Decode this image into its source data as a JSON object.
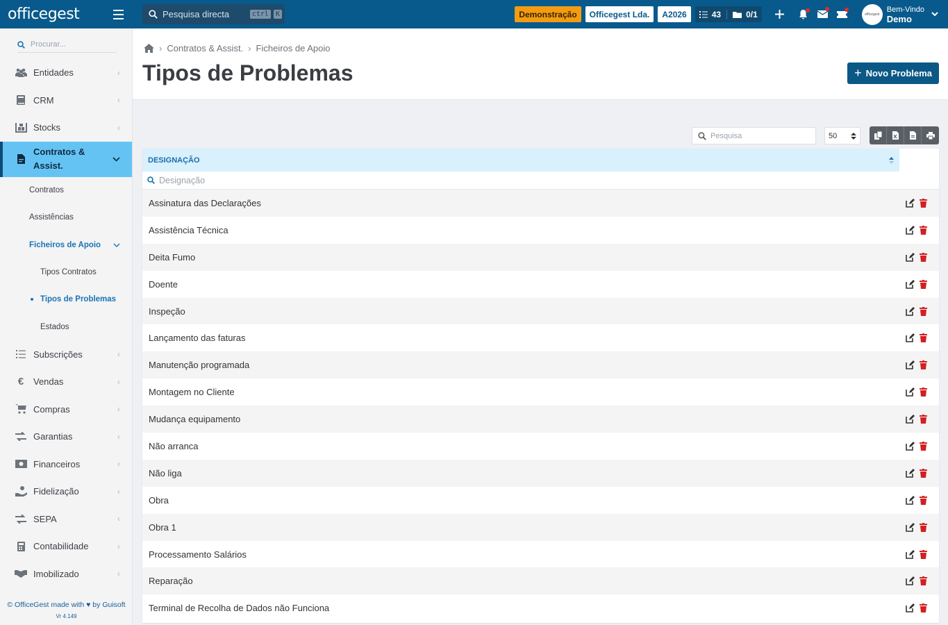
{
  "app": {
    "logo": "officegest"
  },
  "topbar": {
    "quick_search": "Pesquisa directa",
    "kbd1": "ctrl",
    "kbd2": "K",
    "demo": "Demonstração",
    "company": "Officegest Lda.",
    "year": "A2026",
    "tasks": "43",
    "docs": "0/1",
    "welcome": "Bem-Vindo",
    "user": "Demo",
    "avatar_text": "officegest"
  },
  "sidebar": {
    "search_placeholder": "Procurar...",
    "items_top": [
      {
        "label": "Entidades",
        "icon": "users-icon"
      },
      {
        "label": "CRM",
        "icon": "book-icon"
      },
      {
        "label": "Stocks",
        "icon": "warehouse-icon"
      }
    ],
    "active": {
      "label": "Contratos & Assist.",
      "icon": "contract-icon"
    },
    "sub": {
      "contratos": "Contratos",
      "assistencias": "Assistências",
      "ficheiros": "Ficheiros de Apoio",
      "tipos_contratos": "Tipos Contratos",
      "tipos_problemas": "Tipos de Problemas",
      "estados": "Estados"
    },
    "items_bottom": [
      {
        "label": "Subscrições",
        "icon": "list-icon"
      },
      {
        "label": "Vendas",
        "icon": "euro-icon"
      },
      {
        "label": "Compras",
        "icon": "cart-icon"
      },
      {
        "label": "Garantias",
        "icon": "exchange-icon"
      },
      {
        "label": "Financeiros",
        "icon": "money-icon"
      },
      {
        "label": "Fidelização",
        "icon": "hand-coin-icon"
      },
      {
        "label": "SEPA",
        "icon": "exchange-icon"
      },
      {
        "label": "Contabilidade",
        "icon": "calculator-icon"
      },
      {
        "label": "Imobilizado",
        "icon": "handshake-icon"
      }
    ],
    "footer": "© OfficeGest made with ♥ by Guisoft",
    "version": "Vr 4.149"
  },
  "page": {
    "breadcrumb": [
      "Contratos & Assist.",
      "Ficheiros de Apoio"
    ],
    "title": "Tipos de Problemas",
    "new_button": "Novo Problema"
  },
  "toolbar": {
    "search_placeholder": "Pesquisa",
    "page_size": "50"
  },
  "table": {
    "header": "DESIGNAÇÃO",
    "filter_placeholder": "Designação",
    "rows": [
      "Assinatura das Declarações",
      "Assistência Técnica",
      "Deita Fumo",
      "Doente",
      "Inspeção",
      "Lançamento das faturas",
      "Manutenção programada",
      "Montagem no Cliente",
      "Mudança equipamento",
      "Não arranca",
      "Não liga",
      "Obra",
      "Obra 1",
      "Processamento Salários",
      "Reparação",
      "Terminal de Recolha de Dados não Funciona"
    ]
  },
  "colors": {
    "topbar": "#085a8c",
    "sidebar_active": "#65c3f4",
    "accent": "#1a74b4",
    "demo": "#f39c12",
    "delete": "#d32020"
  }
}
